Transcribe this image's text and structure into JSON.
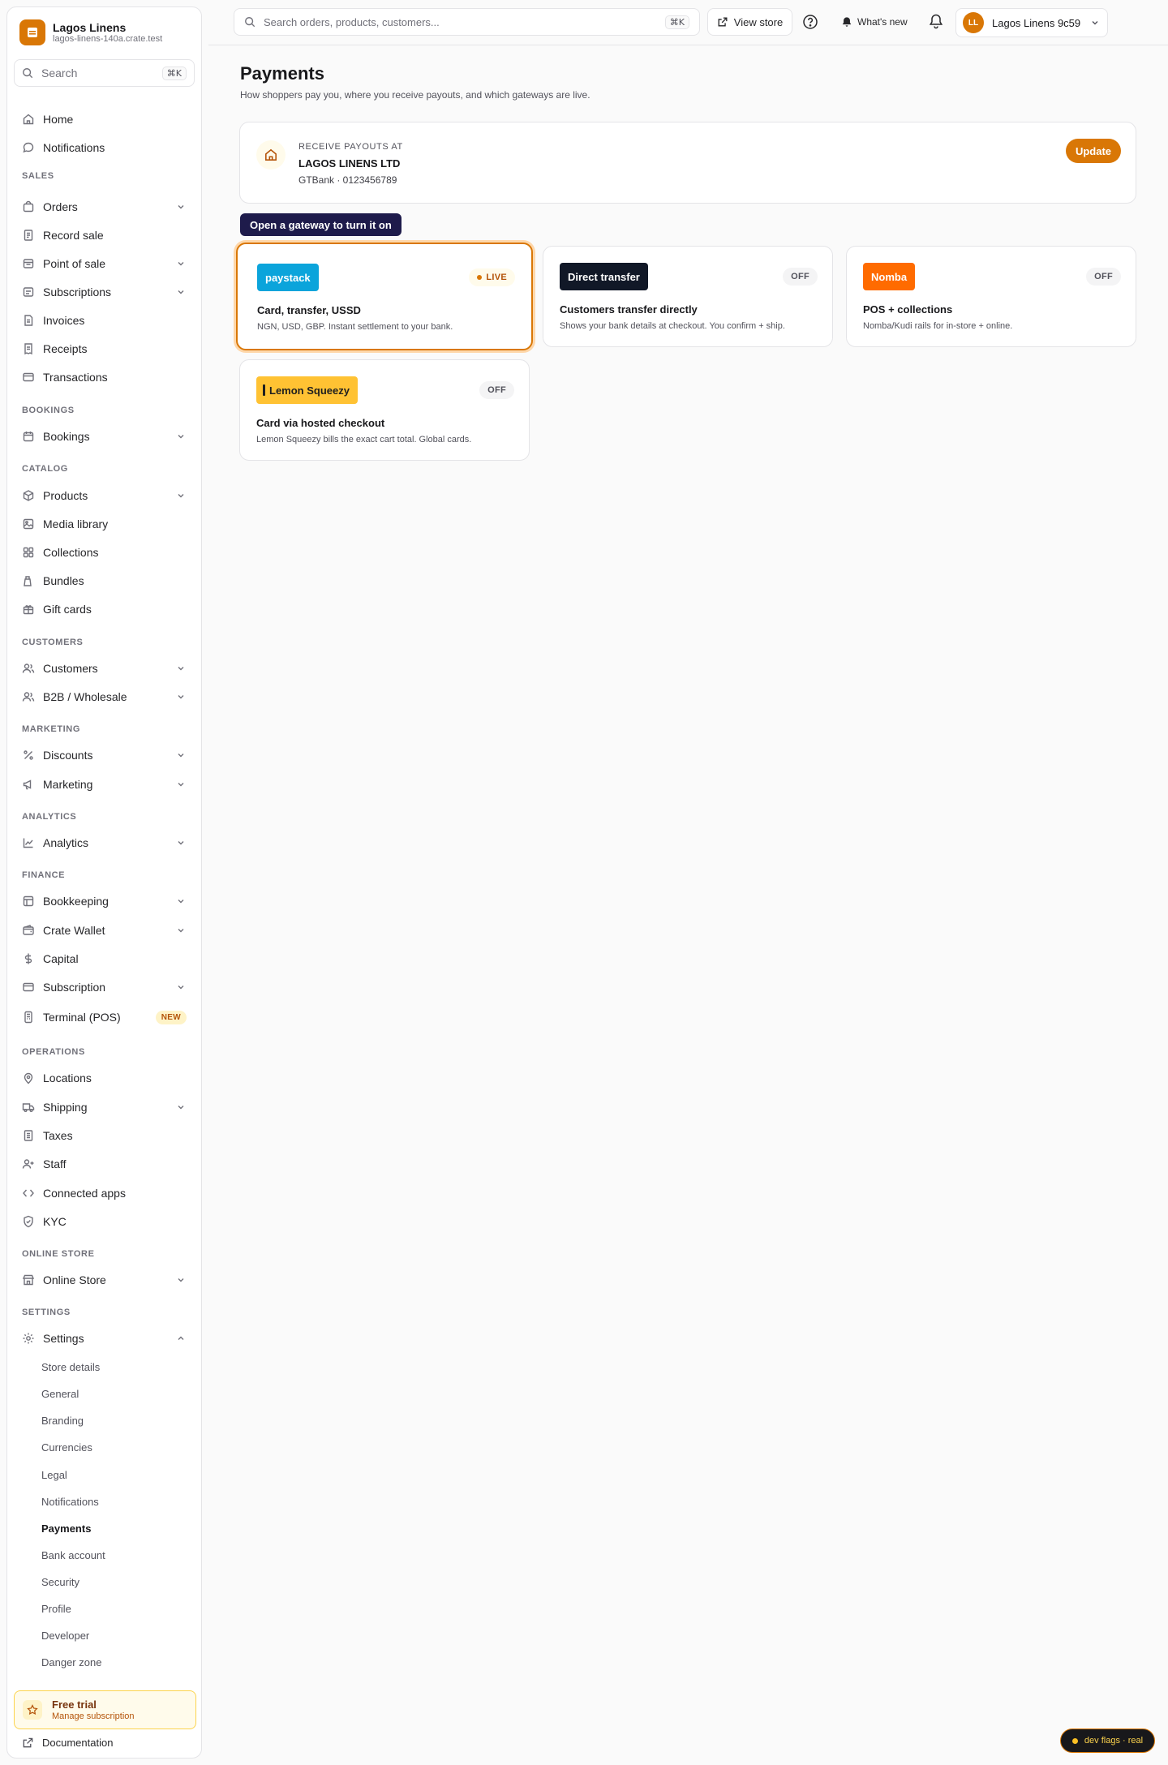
{
  "brand": {
    "name": "Lagos Linens",
    "domain": "lagos-linens-140a.crate.test",
    "accent": "#d97706"
  },
  "sidebar": {
    "search": {
      "label": "Search",
      "shortcut": "⌘K"
    },
    "top_items": [
      {
        "label": "Home",
        "icon": "home-icon"
      },
      {
        "label": "Notifications",
        "icon": "chat-bubble-icon"
      }
    ],
    "sections": {
      "sales": "SALES",
      "bookings": "BOOKINGS",
      "catalog": "CATALOG",
      "customers": "CUSTOMERS",
      "marketing": "MARKETING",
      "analytics": "ANALYTICS",
      "finance": "FINANCE",
      "operations": "OPERATIONS",
      "online_store": "ONLINE STORE",
      "settings": "SETTINGS"
    },
    "items": {
      "orders": "Orders",
      "record_sale": "Record sale",
      "point_of_sale": "Point of sale",
      "subscriptions": "Subscriptions",
      "invoices": "Invoices",
      "receipts": "Receipts",
      "transactions": "Transactions",
      "bookings": "Bookings",
      "products": "Products",
      "media_library": "Media library",
      "collections": "Collections",
      "bundles": "Bundles",
      "gift_cards": "Gift cards",
      "customers": "Customers",
      "b2b": "B2B / Wholesale",
      "discounts": "Discounts",
      "marketing": "Marketing",
      "analytics": "Analytics",
      "bookkeeping": "Bookkeeping",
      "crate_wallet": "Crate Wallet",
      "capital": "Capital",
      "subscription": "Subscription",
      "terminal": "Terminal (POS)",
      "terminal_badge": "NEW",
      "locations": "Locations",
      "shipping": "Shipping",
      "taxes": "Taxes",
      "staff": "Staff",
      "connected_apps": "Connected apps",
      "kyc": "KYC",
      "online_store": "Online Store",
      "settings": "Settings"
    },
    "settings_sub": [
      "Store details",
      "General",
      "Branding",
      "Currencies",
      "Legal",
      "Notifications",
      "Payments",
      "Bank account",
      "Security",
      "Profile",
      "Developer",
      "Danger zone"
    ],
    "active_sub": "Payments",
    "trial": {
      "title": "Free trial",
      "subtitle": "Manage subscription"
    },
    "docs": "Documentation"
  },
  "topbar": {
    "search_placeholder": "Search orders, products, customers...",
    "search_shortcut": "⌘K",
    "view_store": "View store",
    "whats_new": "What's new",
    "account": {
      "initials": "LL",
      "name": "Lagos Linens 9c59"
    }
  },
  "main": {
    "title": "Payments",
    "subtitle": "How shoppers pay you, where you receive payouts, and which gateways are live.",
    "payout": {
      "label": "RECEIVE PAYOUTS AT",
      "name": "LAGOS LINENS LTD",
      "account": "GTBank · 0123456789",
      "button": "Update"
    },
    "tooltip": "Open a gateway to turn it on",
    "gateways": [
      {
        "logo": "paystack",
        "logo_color": "#0ba4db",
        "status": "LIVE",
        "title": "Card, transfer, USSD",
        "desc": "NGN, USD, GBP. Instant settlement to your bank."
      },
      {
        "logo": "Direct transfer",
        "logo_color": "#111827",
        "status": "OFF",
        "title": "Customers transfer directly",
        "desc": "Shows your bank details at checkout. You confirm + ship."
      },
      {
        "logo": "Nomba",
        "logo_color": "#ff6b00",
        "status": "OFF",
        "title": "POS + collections",
        "desc": "Nomba/Kudi rails for in-store + online."
      },
      {
        "logo": "Lemon Squeezy",
        "logo_color": "#ffc233",
        "status": "OFF",
        "title": "Card via hosted checkout",
        "desc": "Lemon Squeezy bills the exact cart total. Global cards."
      }
    ]
  },
  "dev_flags": "dev flags · real"
}
